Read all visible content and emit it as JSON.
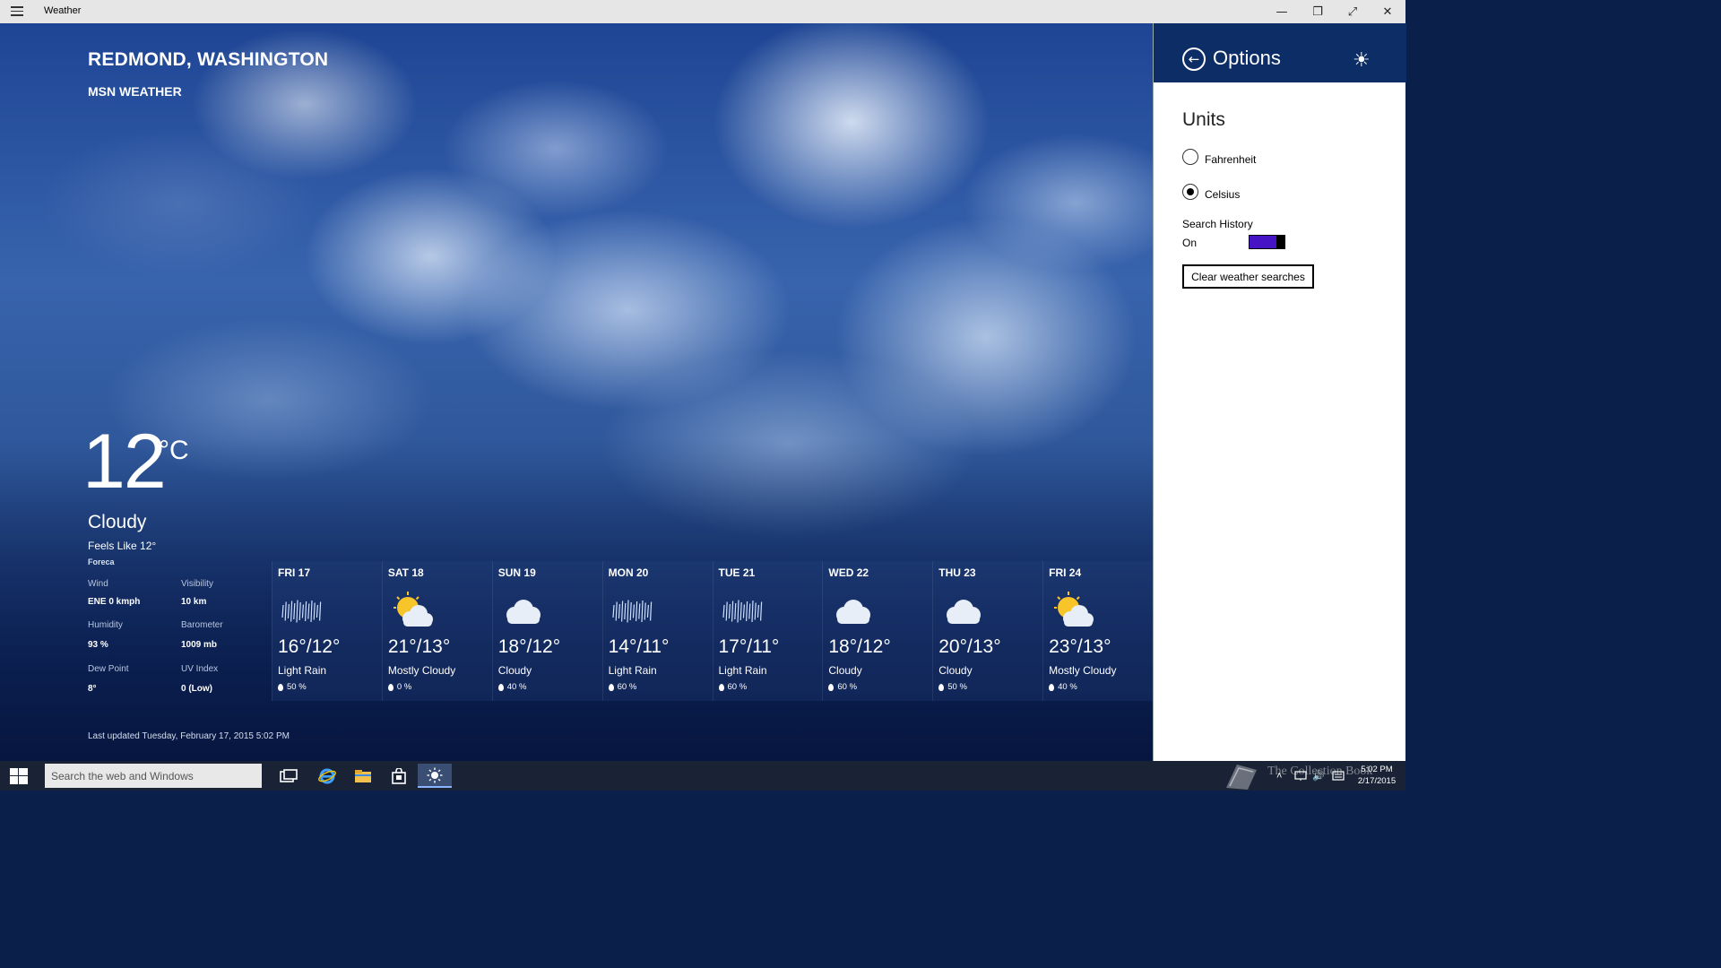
{
  "window": {
    "title": "Weather",
    "controls": {
      "minimize": "—",
      "restore": "❐",
      "fullscreen": "⤢",
      "close": "✕"
    }
  },
  "location": {
    "city": "REDMOND, WASHINGTON",
    "provider": "MSN WEATHER"
  },
  "current": {
    "temperature": "12",
    "unit": "°C",
    "condition": "Cloudy",
    "feels_like": "Feels Like 12°",
    "source": "Foreca",
    "details": {
      "wind_label": "Wind",
      "wind_value": "ENE 0 kmph",
      "visibility_label": "Visibility",
      "visibility_value": "10 km",
      "humidity_label": "Humidity",
      "humidity_value": "93 %",
      "barometer_label": "Barometer",
      "barometer_value": "1009 mb",
      "dewpoint_label": "Dew Point",
      "dewpoint_value": "8°",
      "uv_label": "UV Index",
      "uv_value": "0 (Low)"
    },
    "last_updated": "Last updated Tuesday, February 17, 2015 5:02 PM"
  },
  "forecast": [
    {
      "day": "FRI 17",
      "icon": "rain-icon",
      "hilo": "16°/12°",
      "condition": "Light Rain",
      "precip": "50 %"
    },
    {
      "day": "SAT 18",
      "icon": "partly-sunny-icon",
      "hilo": "21°/13°",
      "condition": "Mostly Cloudy",
      "precip": "0 %"
    },
    {
      "day": "SUN 19",
      "icon": "cloud-icon",
      "hilo": "18°/12°",
      "condition": "Cloudy",
      "precip": "40 %"
    },
    {
      "day": "MON 20",
      "icon": "rain-icon",
      "hilo": "14°/11°",
      "condition": "Light Rain",
      "precip": "60 %"
    },
    {
      "day": "TUE 21",
      "icon": "rain-icon",
      "hilo": "17°/11°",
      "condition": "Light Rain",
      "precip": "60 %"
    },
    {
      "day": "WED 22",
      "icon": "cloud-icon",
      "hilo": "18°/12°",
      "condition": "Cloudy",
      "precip": "60 %"
    },
    {
      "day": "THU 23",
      "icon": "cloud-icon",
      "hilo": "20°/13°",
      "condition": "Cloudy",
      "precip": "50 %"
    },
    {
      "day": "FRI 24",
      "icon": "partly-sunny-icon",
      "hilo": "23°/13°",
      "condition": "Mostly Cloudy",
      "precip": "40 %"
    }
  ],
  "options": {
    "title": "Options",
    "units_heading": "Units",
    "fahrenheit_label": "Fahrenheit",
    "celsius_label": "Celsius",
    "selected_unit": "Celsius",
    "search_history_label": "Search History",
    "search_history_state": "On",
    "clear_button": "Clear weather searches",
    "header_color": "#0d2d66",
    "toggle_color": "#4614c4"
  },
  "taskbar": {
    "search_placeholder": "Search the web and Windows",
    "apps": [
      "task-view-icon",
      "internet-explorer-icon",
      "file-explorer-icon",
      "store-icon",
      "weather-app-icon"
    ],
    "clock_time": "5:02 PM",
    "clock_date": "2/17/2015",
    "watermark": "The Collection Book"
  }
}
